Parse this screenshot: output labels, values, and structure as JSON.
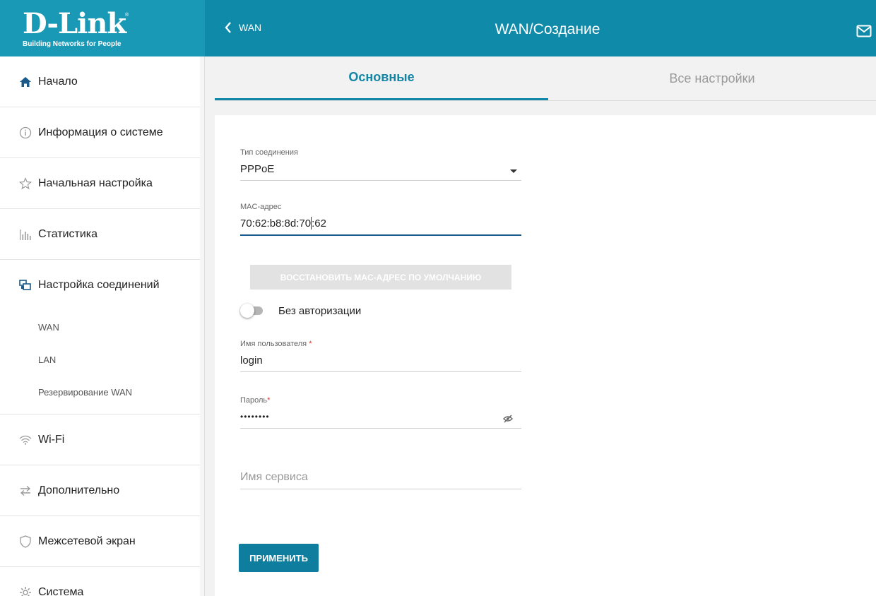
{
  "logo": {
    "main": "D-Link",
    "registered": "®",
    "tagline": "Building Networks for People"
  },
  "header": {
    "back_label": "WAN",
    "title": "WAN/Создание"
  },
  "sidebar": {
    "items": [
      {
        "label": "Начало",
        "icon": "home-icon"
      },
      {
        "label": "Информация о системе",
        "icon": "info-icon"
      },
      {
        "label": "Начальная настройка",
        "icon": "star-icon"
      },
      {
        "label": "Статистика",
        "icon": "bar-chart-icon"
      },
      {
        "label": "Настройка соединений",
        "icon": "connections-icon"
      },
      {
        "label": "Wi-Fi",
        "icon": "wifi-icon"
      },
      {
        "label": "Дополнительно",
        "icon": "arrows-icon"
      },
      {
        "label": "Межсетевой экран",
        "icon": "shield-icon"
      },
      {
        "label": "Система",
        "icon": "gear-icon"
      }
    ],
    "subitems": [
      "WAN",
      "LAN",
      "Резервирование WAN"
    ]
  },
  "tabs": [
    {
      "label": "Основные",
      "active": true
    },
    {
      "label": "Все настройки",
      "active": false
    }
  ],
  "form": {
    "connection_type": {
      "label": "Тип соединения",
      "value": "PPPoE"
    },
    "mac": {
      "label": "MAC-адрес",
      "value_before_caret": "70:62:b8:8d:70",
      "value_after_caret": ":62"
    },
    "restore_button": "ВОССТАНОВИТЬ MAC-АДРЕС ПО УМОЛЧАНИЮ",
    "no_auth": {
      "label": "Без авторизации",
      "enabled": false
    },
    "username": {
      "label": "Имя пользователя",
      "required_mark": "*",
      "value": "login"
    },
    "password": {
      "label": "Пароль",
      "required_mark": "*",
      "masked_value": "••••••••"
    },
    "service_name": {
      "placeholder": "Имя сервиса"
    },
    "apply_button": "ПРИМЕНИТЬ"
  },
  "colors": {
    "header": "#0f8aa9",
    "accent": "#1486a5",
    "apply": "#0f7d9e"
  }
}
